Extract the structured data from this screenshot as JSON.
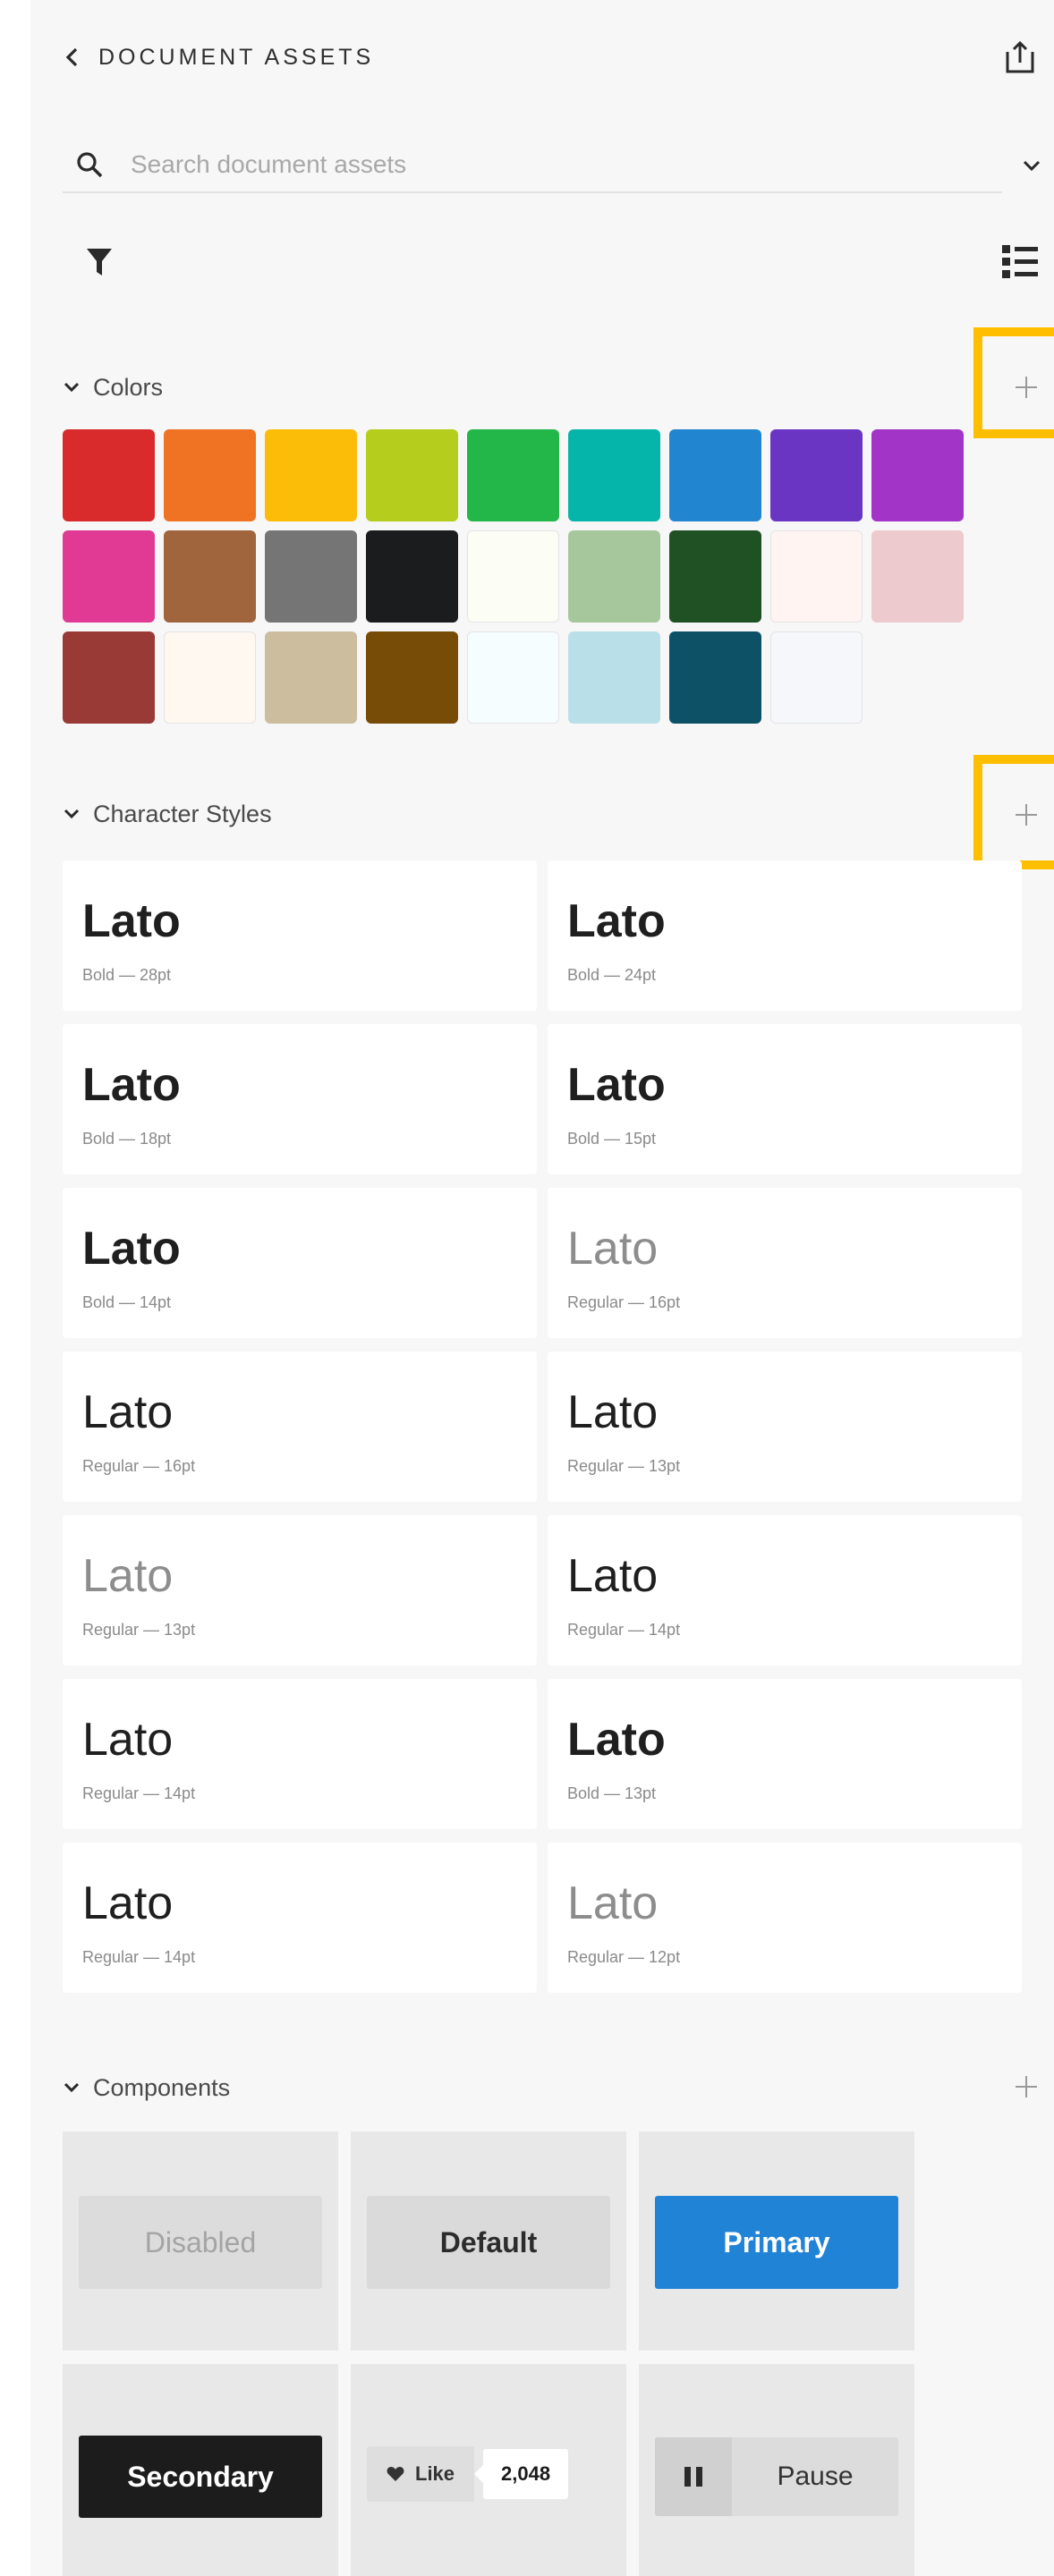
{
  "header": {
    "title": "DOCUMENT ASSETS"
  },
  "search": {
    "placeholder": "Search document assets"
  },
  "sections": {
    "colors": {
      "title": "Colors"
    },
    "character_styles": {
      "title": "Character Styles"
    },
    "components": {
      "title": "Components"
    }
  },
  "colors": [
    "#d92b2b",
    "#ef7322",
    "#fbbd08",
    "#b5cd1c",
    "#23b74a",
    "#06b5aa",
    "#2185d0",
    "#6b35c4",
    "#a234c7",
    "#e13a95",
    "#a1653d",
    "#757575",
    "#1b1c1d",
    "#fcfef5",
    "#a6c79b",
    "#1f5125",
    "#fff4f1",
    "#eccacd",
    "#9a3a37",
    "#fff8f0",
    "#cbbd9e",
    "#774c06",
    "#f6fdff",
    "#b9dfe8",
    "#0d5166",
    "#f6f7fa"
  ],
  "character_styles": [
    {
      "font": "Lato",
      "meta": "Bold — 28pt",
      "weight": "bold"
    },
    {
      "font": "Lato",
      "meta": "Bold — 24pt",
      "weight": "bold"
    },
    {
      "font": "Lato",
      "meta": "Bold — 18pt",
      "weight": "bold"
    },
    {
      "font": "Lato",
      "meta": "Bold — 15pt",
      "weight": "bold"
    },
    {
      "font": "Lato",
      "meta": "Bold — 14pt",
      "weight": "bold"
    },
    {
      "font": "Lato",
      "meta": "Regular — 16pt",
      "weight": "light"
    },
    {
      "font": "Lato",
      "meta": "Regular — 16pt",
      "weight": "regular"
    },
    {
      "font": "Lato",
      "meta": "Regular — 13pt",
      "weight": "regular"
    },
    {
      "font": "Lato",
      "meta": "Regular — 13pt",
      "weight": "light"
    },
    {
      "font": "Lato",
      "meta": "Regular — 14pt",
      "weight": "regular"
    },
    {
      "font": "Lato",
      "meta": "Regular — 14pt",
      "weight": "regular"
    },
    {
      "font": "Lato",
      "meta": "Bold — 13pt",
      "weight": "bold"
    },
    {
      "font": "Lato",
      "meta": "Regular — 14pt",
      "weight": "regular"
    },
    {
      "font": "Lato",
      "meta": "Regular — 12pt",
      "weight": "light"
    }
  ],
  "components": {
    "disabled": "Disabled",
    "default": "Default",
    "primary": "Primary",
    "secondary": "Secondary",
    "like": "Like",
    "like_count": "2,048",
    "pause": "Pause"
  },
  "accent": {
    "highlight": "#ffbf00",
    "primary": "#2183d6"
  },
  "icons": [
    "back-icon",
    "share-icon",
    "search-icon",
    "chevron-down-icon",
    "filter-icon",
    "list-view-icon",
    "plus-icon",
    "heart-icon",
    "pause-icon"
  ]
}
